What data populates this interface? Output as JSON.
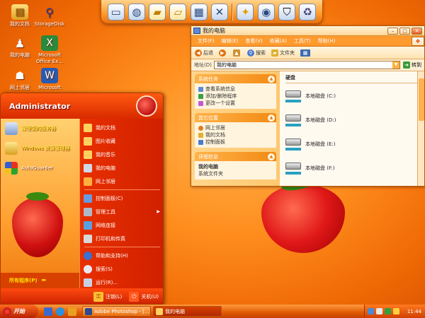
{
  "desktop": {
    "icons": [
      {
        "label": "我的文档",
        "icon": "my-documents-icon"
      },
      {
        "label": "StorageDisk",
        "icon": "usb-drive-icon"
      },
      {
        "label": "我的电脑",
        "icon": "my-computer-icon"
      },
      {
        "label": "Microsoft Office Ex...",
        "icon": "excel-icon"
      },
      {
        "label": "网上邻居",
        "icon": "network-places-icon"
      },
      {
        "label": "Microsoft",
        "icon": "word-icon"
      }
    ]
  },
  "dock": {
    "icons": [
      "monitor-icon",
      "globe-network-icon",
      "folder-icon",
      "folder-open-icon",
      "folder-tools-icon",
      "tools-icon",
      "magic-wand-icon",
      "globe-icon",
      "tshirt-icon",
      "recycle-bin-icon"
    ]
  },
  "explorer": {
    "title": "我的电脑",
    "menu": [
      "文件(F)",
      "编辑(E)",
      "查看(V)",
      "收藏(A)",
      "工具(T)",
      "帮助(H)"
    ],
    "toolbar": {
      "back": "后退",
      "forward": "",
      "search": "搜索",
      "folders": "文件夹",
      "views": ""
    },
    "address": {
      "label": "地址(D)",
      "value": "我的电脑",
      "go": "转到"
    },
    "system_tasks": {
      "title": "系统任务",
      "items": [
        "查看系统信息",
        "添加/删除程序",
        "更改一个设置"
      ]
    },
    "other_places": {
      "title": "其它位置",
      "items": [
        "网上邻居",
        "我的文档",
        "控制面板"
      ]
    },
    "details": {
      "title": "详细信息",
      "name": "我的电脑",
      "type": "系统文件夹"
    },
    "content": {
      "section_title": "硬盘",
      "drives": [
        {
          "name": "本地磁盘 (C:)"
        },
        {
          "name": "本地磁盘 (D:)"
        },
        {
          "name": "本地磁盘 (E:)"
        },
        {
          "name": "本地磁盘 (F:)"
        }
      ]
    }
  },
  "start_menu": {
    "user": "Administrator",
    "pinned": [
      {
        "label": "管理您的服务器",
        "icon": "server-manager-icon"
      },
      {
        "label": "Windows 资源管理器",
        "icon": "explorer-icon"
      },
      {
        "label": "AutoGuarder",
        "icon": "shield-icon"
      }
    ],
    "all_programs": "所有程序(P)",
    "right_items": [
      {
        "label": "我的文档",
        "icon": "my-documents-icon",
        "submenu": false
      },
      {
        "label": "图片收藏",
        "icon": "my-pictures-icon",
        "submenu": false
      },
      {
        "label": "我的音乐",
        "icon": "my-music-icon",
        "submenu": false
      },
      {
        "label": "我的电脑",
        "icon": "my-computer-icon",
        "submenu": false
      },
      {
        "label": "网上邻居",
        "icon": "network-places-icon",
        "submenu": false
      },
      {
        "label": "控制面板(C)",
        "icon": "control-panel-icon",
        "submenu": false
      },
      {
        "label": "管理工具",
        "icon": "admin-tools-icon",
        "submenu": true
      },
      {
        "label": "网络连接",
        "icon": "network-connections-icon",
        "submenu": false
      },
      {
        "label": "打印机和传真",
        "icon": "printer-icon",
        "submenu": false
      },
      {
        "label": "帮助和支持(H)",
        "icon": "help-icon",
        "submenu": false
      },
      {
        "label": "搜索(S)",
        "icon": "search-icon",
        "submenu": false
      },
      {
        "label": "运行(R)...",
        "icon": "run-icon",
        "submenu": false
      }
    ],
    "logoff": "注销(L)",
    "shutdown": "关机(U)"
  },
  "taskbar": {
    "start": "开始",
    "quick_launch": [
      "show-desktop-icon",
      "ie-icon",
      "media-player-icon"
    ],
    "tasks": [
      {
        "label": "Adobe Photoshop - [...",
        "active": false
      },
      {
        "label": "我的电脑",
        "active": true
      }
    ],
    "clock": "11:44"
  },
  "colors": {
    "accent": "#ff8a1c",
    "start_menu_red": "#d82a00",
    "window_menubar": "#ff9a2e"
  }
}
